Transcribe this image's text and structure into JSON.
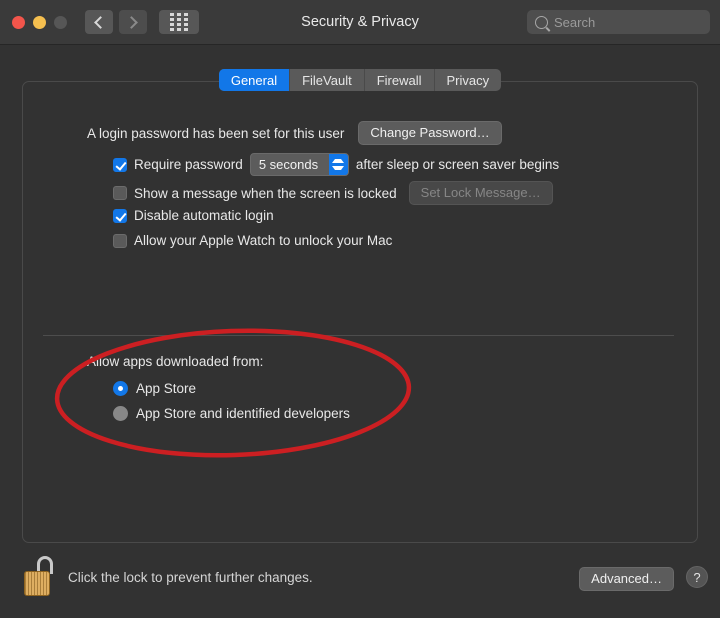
{
  "window": {
    "title": "Security & Privacy",
    "traffic_lights": [
      "close",
      "minimize",
      "zoom-disabled"
    ],
    "nav": {
      "back": "back-chevron",
      "forward": "forward-chevron",
      "grid": "show-all-grid"
    },
    "search": {
      "placeholder": "Search",
      "value": "",
      "icon": "search-icon"
    }
  },
  "tabs": [
    {
      "label": "General",
      "active": true
    },
    {
      "label": "FileVault",
      "active": false
    },
    {
      "label": "Firewall",
      "active": false
    },
    {
      "label": "Privacy",
      "active": false
    }
  ],
  "general": {
    "password_status": "A login password has been set for this user",
    "change_password_label": "Change Password…",
    "require_password": {
      "checked": true,
      "label": "Require password",
      "delay_value": "5 seconds",
      "suffix": "after sleep or screen saver begins"
    },
    "show_message": {
      "checked": false,
      "label": "Show a message when the screen is locked",
      "button_label": "Set Lock Message…",
      "button_disabled": true
    },
    "disable_auto_login": {
      "checked": true,
      "label": "Disable automatic login"
    },
    "apple_watch": {
      "checked": false,
      "label": "Allow your Apple Watch to unlock your Mac"
    },
    "gatekeeper": {
      "heading": "Allow apps downloaded from:",
      "options": [
        {
          "label": "App Store",
          "selected": true
        },
        {
          "label": "App Store and identified developers",
          "selected": false
        }
      ]
    }
  },
  "footer": {
    "lock_icon": "padlock-open-icon",
    "lock_message": "Click the lock to prevent further changes.",
    "advanced_label": "Advanced…",
    "help_label": "?"
  },
  "annotation": {
    "shape": "ellipse",
    "color": "#cc1f22",
    "target": "Allow apps downloaded from"
  },
  "colors": {
    "accent": "#1277e8",
    "window_bg": "#323232",
    "titlebar_bg": "#3a3a3a",
    "annotation_red": "#cc1f22",
    "lock_gold": "#d9a24a"
  }
}
